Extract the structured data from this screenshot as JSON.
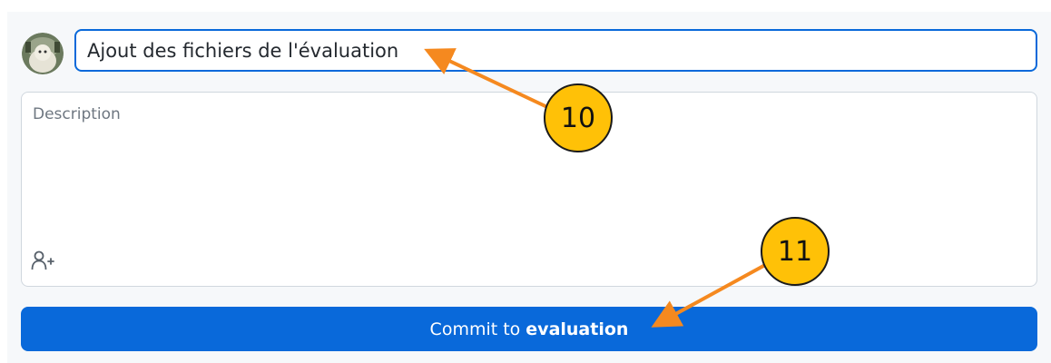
{
  "commit": {
    "summary_value": "Ajout des fichiers de l'évaluation",
    "description_placeholder": "Description",
    "button_prefix": "Commit to",
    "button_branch": "evaluation"
  },
  "annotations": [
    {
      "label": "10"
    },
    {
      "label": "11"
    }
  ],
  "colors": {
    "accent": "#0969da",
    "callout": "#ffc107",
    "arrow": "#f5891f"
  },
  "icons": [
    "avatar",
    "add-coauthor-icon"
  ]
}
